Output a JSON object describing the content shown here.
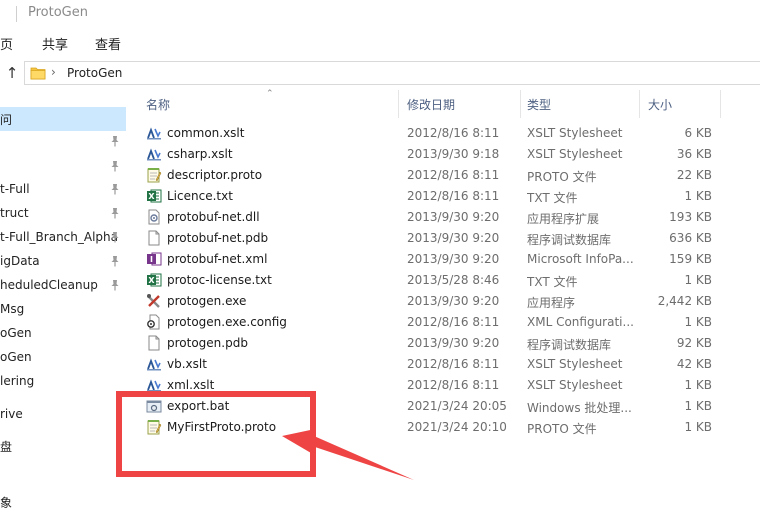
{
  "window": {
    "title": "ProtoGen"
  },
  "ribbon": {
    "tabs": [
      "页",
      "共享",
      "查看"
    ]
  },
  "address": {
    "crumbs": [
      "ProtoGen"
    ]
  },
  "nav": {
    "items": [
      {
        "label": "问",
        "selected": true,
        "pinned": false
      },
      {
        "label": "",
        "selected": false,
        "pinned": true
      },
      {
        "label": "",
        "selected": false,
        "pinned": true
      },
      {
        "label": "t-Full",
        "selected": false,
        "pinned": true
      },
      {
        "label": "truct",
        "selected": false,
        "pinned": true
      },
      {
        "label": "t-Full_Branch_Alpha",
        "selected": false,
        "pinned": true
      },
      {
        "label": "igData",
        "selected": false,
        "pinned": true
      },
      {
        "label": "heduledCleanup",
        "selected": false,
        "pinned": true
      },
      {
        "label": "Msg",
        "selected": false,
        "pinned": false
      },
      {
        "label": "oGen",
        "selected": false,
        "pinned": false
      },
      {
        "label": "oGen",
        "selected": false,
        "pinned": false
      },
      {
        "label": "lering",
        "selected": false,
        "pinned": false
      },
      {
        "label": "",
        "selected": false,
        "pinned": false
      },
      {
        "label": "rive",
        "selected": false,
        "pinned": false
      },
      {
        "label": "盘",
        "selected": false,
        "pinned": false
      },
      {
        "label": "",
        "selected": false,
        "pinned": false
      },
      {
        "label": "象",
        "selected": false,
        "pinned": false
      }
    ]
  },
  "columns": {
    "name": "名称",
    "modified": "修改日期",
    "type": "类型",
    "size": "大小"
  },
  "files": [
    {
      "name": "common.xslt",
      "modified": "2012/8/16 8:11",
      "type": "XSLT Stylesheet",
      "size": "6 KB",
      "icon": "xslt-icon"
    },
    {
      "name": "csharp.xslt",
      "modified": "2013/9/30 9:18",
      "type": "XSLT Stylesheet",
      "size": "36 KB",
      "icon": "xslt-icon"
    },
    {
      "name": "descriptor.proto",
      "modified": "2012/8/16 8:11",
      "type": "PROTO 文件",
      "size": "22 KB",
      "icon": "notepad-icon"
    },
    {
      "name": "Licence.txt",
      "modified": "2012/8/16 8:11",
      "type": "TXT 文件",
      "size": "1 KB",
      "icon": "excel-icon"
    },
    {
      "name": "protobuf-net.dll",
      "modified": "2013/9/30 9:20",
      "type": "应用程序扩展",
      "size": "193 KB",
      "icon": "dll-icon"
    },
    {
      "name": "protobuf-net.pdb",
      "modified": "2013/9/30 9:20",
      "type": "程序调试数据库",
      "size": "636 KB",
      "icon": "file-icon"
    },
    {
      "name": "protobuf-net.xml",
      "modified": "2013/9/30 9:20",
      "type": "Microsoft InfoPa...",
      "size": "159 KB",
      "icon": "infopath-icon"
    },
    {
      "name": "protoc-license.txt",
      "modified": "2013/5/28 8:46",
      "type": "TXT 文件",
      "size": "1 KB",
      "icon": "excel-icon"
    },
    {
      "name": "protogen.exe",
      "modified": "2013/9/30 9:20",
      "type": "应用程序",
      "size": "2,442 KB",
      "icon": "exe-icon"
    },
    {
      "name": "protogen.exe.config",
      "modified": "2012/8/16 8:11",
      "type": "XML Configurati...",
      "size": "1 KB",
      "icon": "config-icon"
    },
    {
      "name": "protogen.pdb",
      "modified": "2013/9/30 9:20",
      "type": "程序调试数据库",
      "size": "92 KB",
      "icon": "file-icon"
    },
    {
      "name": "vb.xslt",
      "modified": "2012/8/16 8:11",
      "type": "XSLT Stylesheet",
      "size": "42 KB",
      "icon": "xslt-icon"
    },
    {
      "name": "xml.xslt",
      "modified": "2012/8/16 8:11",
      "type": "XSLT Stylesheet",
      "size": "1 KB",
      "icon": "xslt-icon"
    },
    {
      "name": "export.bat",
      "modified": "2021/3/24 20:05",
      "type": "Windows 批处理...",
      "size": "1 KB",
      "icon": "bat-icon"
    },
    {
      "name": "MyFirstProto.proto",
      "modified": "2021/3/24 20:10",
      "type": "PROTO 文件",
      "size": "1 KB",
      "icon": "notepad-icon"
    }
  ],
  "colors": {
    "selection": "#cce8ff",
    "annotation": "#ef4444",
    "header_text": "#4d6082"
  }
}
